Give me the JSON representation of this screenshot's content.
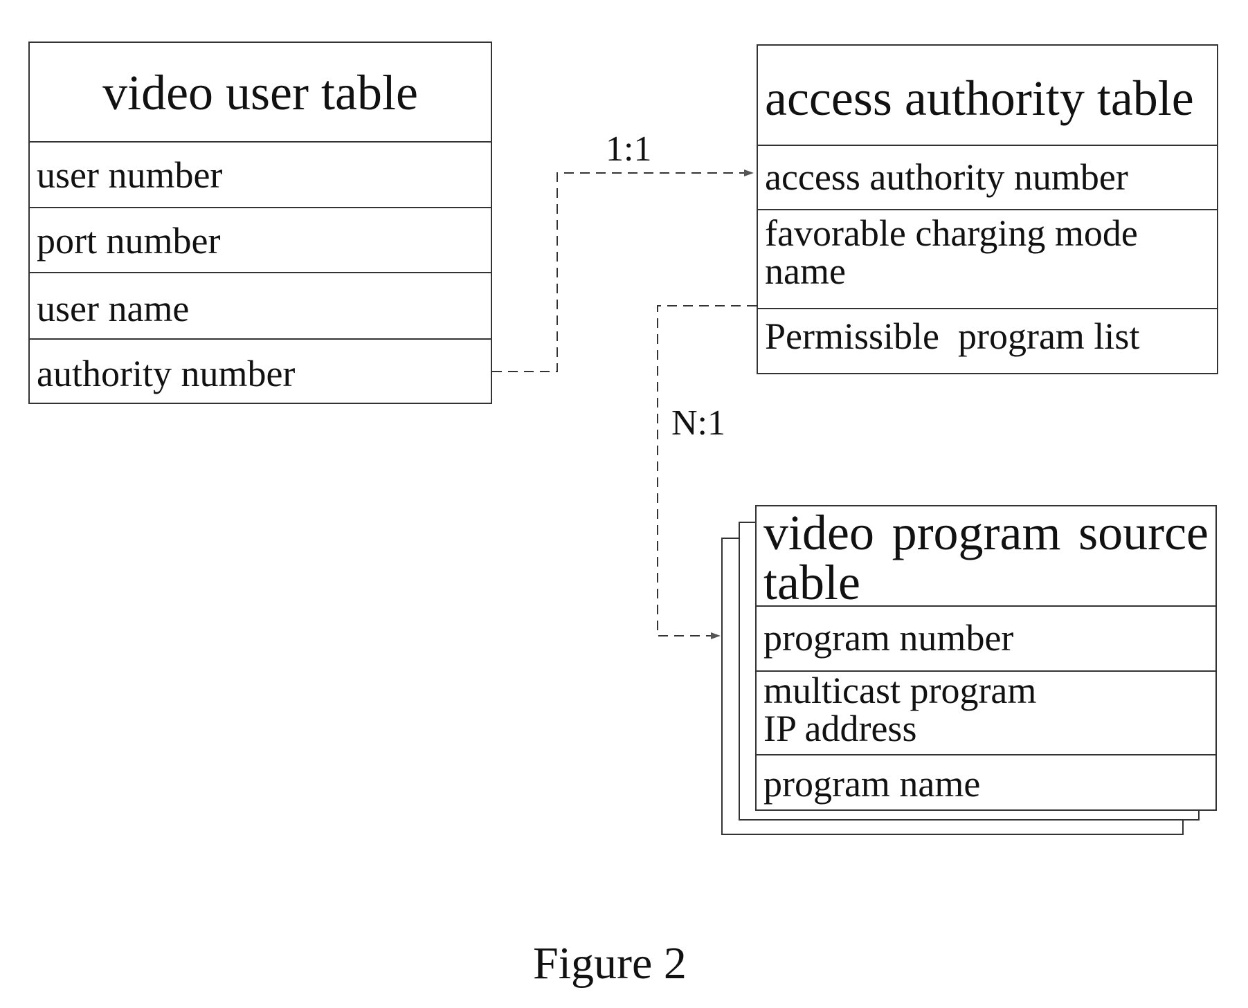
{
  "figure": {
    "caption": "Figure 2"
  },
  "tables": {
    "video_user": {
      "title": "video user table",
      "fields": [
        "user number",
        "port number",
        "user name",
        "authority number"
      ]
    },
    "access_authority": {
      "title": "access authority table",
      "fields": [
        "access authority number",
        "favorable charging mode name",
        "Permissible  program list"
      ]
    },
    "video_program_source": {
      "title": "video program source table",
      "fields": [
        "program number",
        "multicast program IP address",
        "program name"
      ]
    }
  },
  "relations": [
    {
      "from": "video user table.authority number",
      "to": "access authority table.access authority number",
      "label": "1:1",
      "style": "dashed-arrow"
    },
    {
      "from": "access authority table.favorable charging mode name",
      "to": "video program source table.program number",
      "label": "N:1",
      "style": "dashed-arrow"
    }
  ]
}
